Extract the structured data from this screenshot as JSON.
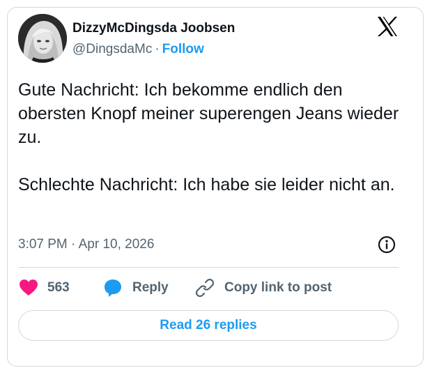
{
  "author": {
    "name": "DizzyMcDingsda Joobsen",
    "handle": "@DingsdaMc",
    "separator": "·",
    "follow_label": "Follow"
  },
  "post": {
    "paragraphs": [
      "Gute Nachricht: Ich bekomme endlich den obersten Knopf meiner superengen Jeans wieder zu.",
      "Schlechte Nachricht: Ich habe sie leider nicht an."
    ],
    "timestamp": "3:07 PM · Apr 10, 2026"
  },
  "actions": {
    "like_count": "563",
    "reply_label": "Reply",
    "copy_label": "Copy link to post"
  },
  "read_replies_label": "Read 26 replies",
  "icons": {
    "brand": "x-logo-icon",
    "info": "info-icon",
    "like": "heart-icon",
    "reply": "speech-bubble-icon",
    "copy": "link-icon"
  },
  "colors": {
    "accent": "#1d9bf0",
    "like": "#f91880",
    "text": "#0f1419",
    "secondary": "#536471",
    "border": "#cfd9de"
  }
}
